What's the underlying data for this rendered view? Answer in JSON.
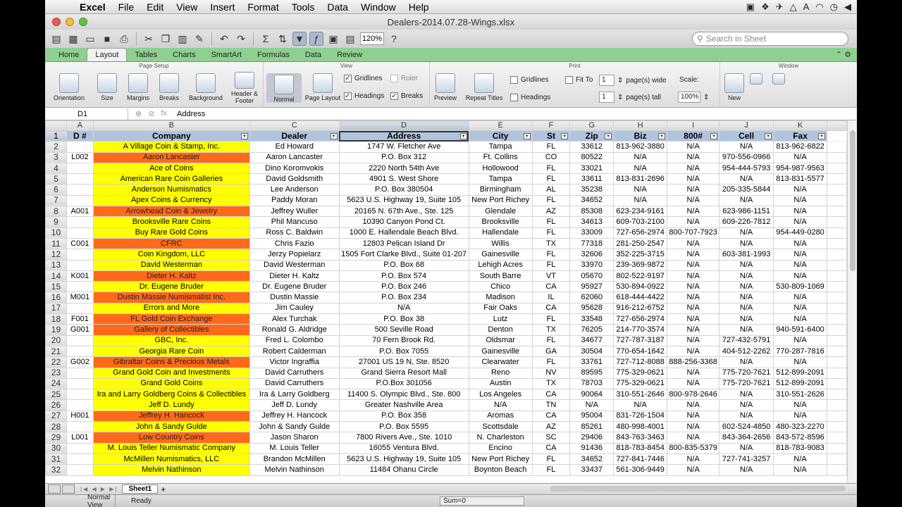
{
  "menubar": {
    "app": "Excel",
    "items": [
      "File",
      "Edit",
      "View",
      "Insert",
      "Format",
      "Tools",
      "Data",
      "Window",
      "Help"
    ]
  },
  "window": {
    "title": "Dealers-2014.07.28-Wings.xlsx"
  },
  "toolbar": {
    "zoom": "120%",
    "search_placeholder": "Search in Sheet"
  },
  "ribbon": {
    "tabs": [
      "Home",
      "Layout",
      "Tables",
      "Charts",
      "SmartArt",
      "Formulas",
      "Data",
      "Review"
    ],
    "active_tab": "Layout",
    "page_setup": {
      "label": "Page Setup",
      "buttons": [
        "Orientation",
        "Size",
        "Margins",
        "Breaks",
        "Background",
        "Header & Footer"
      ]
    },
    "view": {
      "label": "View",
      "normal": "Normal",
      "page_layout": "Page Layout",
      "gridlines": "Gridlines",
      "ruler": "Ruler",
      "headings": "Headings",
      "breaks": "Breaks"
    },
    "print": {
      "label": "Print",
      "preview": "Preview",
      "repeat_titles": "Repeat Titles",
      "gridlines": "Gridlines",
      "headings": "Headings",
      "fit_to": "Fit To",
      "wide_val": "1",
      "wide_label": "page(s) wide",
      "tall_val": "1",
      "tall_label": "page(s) tall",
      "scale_label": "Scale:",
      "scale_val": "100%"
    },
    "window": {
      "label": "Window",
      "new": "New"
    }
  },
  "formula_bar": {
    "cell": "D1",
    "fx": "fx",
    "value": "Address"
  },
  "columns": {
    "letters": [
      "A",
      "B",
      "C",
      "D",
      "E",
      "F",
      "G",
      "H",
      "I",
      "J",
      "K"
    ],
    "headers": [
      "D #",
      "Company",
      "Dealer",
      "Address",
      "City",
      "St",
      "Zip",
      "Biz",
      "800#",
      "Cell",
      "Fax"
    ]
  },
  "rows": [
    [
      "",
      "A Village Coin & Stamp, Inc.",
      "Ed Howard",
      "1747 W. Fletcher Ave",
      "Tampa",
      "FL",
      "33612",
      "813-962-3880",
      "N/A",
      "N/A",
      "813-962-6822"
    ],
    [
      "L002",
      "Aaron Lancaster",
      "Aaron Lancaster",
      "P.O. Box 312",
      "Ft. Collins",
      "CO",
      "80522",
      "N/A",
      "N/A",
      "970-556-0966",
      "N/A"
    ],
    [
      "",
      "Ace of Coins",
      "Dino Koromvokis",
      "2220 North 54th Ave",
      "Hollowood",
      "FL",
      "33021",
      "N/A",
      "N/A",
      "954-444-5793",
      "954-987-9563"
    ],
    [
      "",
      "American Rare Coin Galleries",
      "David Goldsmith",
      "4901 S. West Shore",
      "Tampa",
      "FL",
      "33611",
      "813-831-2696",
      "N/A",
      "N/A",
      "813-831-5577"
    ],
    [
      "",
      "Anderson Numismatics",
      "Lee Anderson",
      "P.O. Box 380504",
      "Birmingham",
      "AL",
      "35238",
      "N/A",
      "N/A",
      "205-335-5844",
      "N/A"
    ],
    [
      "",
      "Apex Coins & Currency",
      "Paddy Moran",
      "5623 U.S. Highway 19, Suite 105",
      "New Port Richey",
      "FL",
      "34652",
      "N/A",
      "N/A",
      "N/A",
      "N/A"
    ],
    [
      "A001",
      "Arrowhead Coin & Jewelry",
      "Jeffrey Wuller",
      "20165 N. 67th Ave., Ste. 125",
      "Glendale",
      "AZ",
      "85308",
      "623-234-9161",
      "N/A",
      "623-986-1151",
      "N/A"
    ],
    [
      "",
      "Brooksville Rare Coins",
      "Phil Mancuso",
      "10390 Canyon Pond Ct.",
      "Brooksville",
      "FL",
      "34613",
      "609-703-2100",
      "N/A",
      "609-226-7812",
      "N/A"
    ],
    [
      "",
      "Buy Rare Gold Coins",
      "Ross C. Baldwin",
      "1000 E. Hallendale Beach Blvd.",
      "Hallendale",
      "FL",
      "33009",
      "727-656-2974",
      "800-707-7923",
      "N/A",
      "954-449-0280"
    ],
    [
      "C001",
      "CFRC",
      "Chris Fazio",
      "12803 Pelican Island Dr",
      "Willis",
      "TX",
      "77318",
      "281-250-2547",
      "N/A",
      "N/A",
      "N/A"
    ],
    [
      "",
      "Coin Kingdom, LLC",
      "Jerzy Popielarz",
      "1505 Fort Clarke Blvd., Suite 01-207",
      "Gainesville",
      "FL",
      "32606",
      "352-225-3715",
      "N/A",
      "603-381-1993",
      "N/A"
    ],
    [
      "",
      "David Westerman",
      "David Westerman",
      "P.O. Box 68",
      "Lehigh Acres",
      "FL",
      "33970",
      "239-369-9872",
      "N/A",
      "N/A",
      "N/A"
    ],
    [
      "K001",
      "Dieter H. Kaltz",
      "Dieter H. Kaltz",
      "P.O. Box 574",
      "South Barre",
      "VT",
      "05670",
      "802-522-9197",
      "N/A",
      "N/A",
      "N/A"
    ],
    [
      "",
      "Dr. Eugene Bruder",
      "Dr. Eugene Bruder",
      "P.O. Box 246",
      "Chico",
      "CA",
      "95927",
      "530-894-0922",
      "N/A",
      "N/A",
      "530-809-1069"
    ],
    [
      "M001",
      "Dustin Massie Numismatist Inc.",
      "Dustin Massie",
      "P.O. Box 234",
      "Madison",
      "IL",
      "62060",
      "618-444-4422",
      "N/A",
      "N/A",
      "N/A"
    ],
    [
      "",
      "Errors and More",
      "Jim Cauley",
      "N/A",
      "Fair Oaks",
      "CA",
      "95628",
      "916-212-6752",
      "N/A",
      "N/A",
      "N/A"
    ],
    [
      "F001",
      "FL Gold Coin Exchange",
      "Alex Turchak",
      "P.O. Box 38",
      "Lutz",
      "FL",
      "33548",
      "727-656-2974",
      "N/A",
      "N/A",
      "N/A"
    ],
    [
      "G001",
      "Gallery of Collectibles",
      "Ronald G. Aldridge",
      "500 Seville Road",
      "Denton",
      "TX",
      "76205",
      "214-770-3574",
      "N/A",
      "N/A",
      "940-591-6400"
    ],
    [
      "",
      "GBC, Inc.",
      "Fred L. Colombo",
      "70 Fern Brook Rd.",
      "Oldsmar",
      "FL",
      "34677",
      "727-787-3187",
      "N/A",
      "727-432-5791",
      "N/A"
    ],
    [
      "",
      "Georgia Rare Coin",
      "Robert Calderman",
      "P.O. Box 7055",
      "Gainesville",
      "GA",
      "30504",
      "770-654-1642",
      "N/A",
      "404-512-2262",
      "770-287-7816"
    ],
    [
      "G002",
      "Gibraltar Coins & Precious Metals",
      "Victor Ingraffia",
      "27001 US 19 N, Ste. 8520",
      "Clearwater",
      "FL",
      "33761",
      "727-712-8088",
      "888-256-3368",
      "N/A",
      "N/A"
    ],
    [
      "",
      "Grand Gold Coin and Investments",
      "David Carruthers",
      "Grand Sierra Resort Mall",
      "Reno",
      "NV",
      "89595",
      "775-329-0621",
      "N/A",
      "775-720-7621",
      "512-899-2091"
    ],
    [
      "",
      "Grand Gold Coins",
      "David Carruthers",
      "P.O.Box 301056",
      "Austin",
      "TX",
      "78703",
      "775-329-0621",
      "N/A",
      "775-720-7621",
      "512-899-2091"
    ],
    [
      "",
      "Ira and Larry Goldberg Coins & Collectibles",
      "Ira & Larry Goldberg",
      "11400 S. Olympic Blvd., Ste. 800",
      "Los Angeles",
      "CA",
      "90064",
      "310-551-2646",
      "800-978-2646",
      "N/A",
      "310-551-2626"
    ],
    [
      "",
      "Jeff D. Lundy",
      "Jeff D. Lundy",
      "Greater Nashville Area",
      "N/A",
      "TN",
      "N/A",
      "N/A",
      "N/A",
      "N/A",
      "N/A"
    ],
    [
      "H001",
      "Jeffrey H. Hancock",
      "Jeffrey H. Hancock",
      "P.O. Box 358",
      "Aromas",
      "CA",
      "95004",
      "831-726-1504",
      "N/A",
      "N/A",
      "N/A"
    ],
    [
      "",
      "John & Sandy Gulde",
      "John & Sandy Gulde",
      "P.O. Box 5595",
      "Scottsdale",
      "AZ",
      "85261",
      "480-998-4001",
      "N/A",
      "602-524-4850",
      "480-323-2270"
    ],
    [
      "L001",
      "Low Country Coins",
      "Jason Sharon",
      "7800 Rivers Ave., Ste. 1010",
      "N. Charleston",
      "SC",
      "29406",
      "843-763-3463",
      "N/A",
      "843-364-2656",
      "843-572-8596"
    ],
    [
      "",
      "M. Louis Teller Numismatic Company",
      "M. Louis Teller",
      "16055 Ventura Blvd.",
      "Encino",
      "CA",
      "91436",
      "818-783-8454",
      "800-835-5379",
      "N/A",
      "818-783-9083"
    ],
    [
      "",
      "McMillen Numismatics, LLC",
      "Brandon McMillen",
      "5623 U.S. Highway 19, Suite 105",
      "New Port Richey",
      "FL",
      "34652",
      "727-841-7446",
      "N/A",
      "727-741-3257",
      "N/A"
    ],
    [
      "",
      "Melvin Nathinson",
      "Melvin Nathinson",
      "11484 Ohanu Circle",
      "Boynton Beach",
      "FL",
      "33437",
      "561-306-9449",
      "N/A",
      "N/A",
      "N/A"
    ]
  ],
  "row_colors": [
    "yel",
    "org",
    "yel",
    "yel",
    "yel",
    "yel",
    "org",
    "yel",
    "yel",
    "org",
    "yel",
    "yel",
    "org",
    "yel",
    "org",
    "yel",
    "org",
    "org",
    "yel",
    "yel",
    "org",
    "yel",
    "yel",
    "yel",
    "yel",
    "org",
    "yel",
    "org",
    "yel",
    "yel",
    "yel"
  ],
  "sheet": {
    "tab": "Sheet1"
  },
  "status": {
    "view": "Normal View",
    "state": "Ready",
    "sum": "Sum=0"
  }
}
